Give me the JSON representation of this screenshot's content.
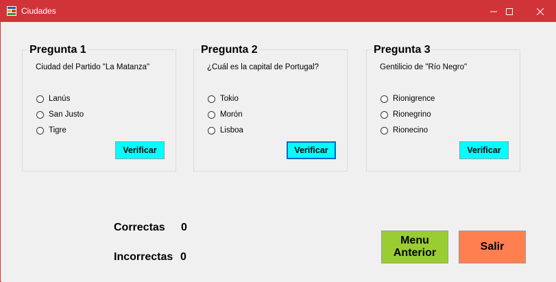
{
  "window": {
    "title": "Ciudades"
  },
  "groups": [
    {
      "title": "Pregunta 1",
      "question": "Ciudad del Partido \"La Matanza\"",
      "options": [
        "Lanús",
        "San Justo",
        "Tigre"
      ],
      "button": "Verificar"
    },
    {
      "title": "Pregunta 2",
      "question": "¿Cuál es la capital de Portugal?",
      "options": [
        "Tokio",
        "Morón",
        "Lisboa"
      ],
      "button": "Verificar"
    },
    {
      "title": "Pregunta 3",
      "question": "Gentilicio de \"Río Negro\"",
      "options": [
        "Rionigrence",
        "Rionegrino",
        "Rionecino"
      ],
      "button": "Verificar"
    }
  ],
  "stats": {
    "correct_label": "Correctas",
    "correct_value": "0",
    "incorrect_label": "Incorrectas",
    "incorrect_value": "0"
  },
  "buttons": {
    "menu_line1": "Menu",
    "menu_line2": "Anterior",
    "exit": "Salir"
  },
  "colors": {
    "titlebar": "#d13438",
    "verify": "#00ffff",
    "menu": "#9acd32",
    "exit": "#ff7f50"
  }
}
